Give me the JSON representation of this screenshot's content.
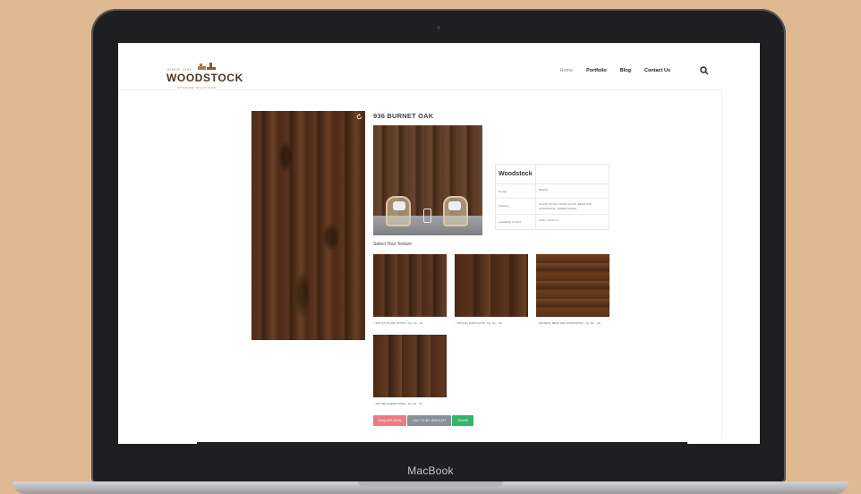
{
  "header": {
    "logo_small": "SINCE 1985",
    "logo_name": "WOODSTOCK",
    "logo_sub": "INTERIOR SOLUTIONS",
    "nav": [
      {
        "label": "Home",
        "active": true
      },
      {
        "label": "Portfolio",
        "active": false
      },
      {
        "label": "Blog",
        "active": false
      },
      {
        "label": "Contact Us",
        "active": false
      }
    ]
  },
  "product": {
    "title": "936 BURNET OAK",
    "spec": {
      "brand": "Woodstock",
      "rows": [
        {
          "label": "Design",
          "value": "BRAND"
        },
        {
          "label": "Features",
          "value": "PLANK STITCH, DESK GLASS, BEAN OAK HORIZONTAL, SUEDE FINISH"
        },
        {
          "label": "Availability & Sizes",
          "value": "1220 x 2440 mm"
        }
      ]
    },
    "select_label": "Select Your Texture",
    "textures": [
      {
        "caption": "936 (ST) PLANK STITCH - Pg. No. : 31"
      },
      {
        "caption": "936 (HG) RAW GLOSS - Pg. No. : 28"
      },
      {
        "caption": "936 (BHO) BEAN OAK HORIZONTAL - Pg. No. : 29"
      },
      {
        "caption": "936 (SE) SUEDE FINISH - Pg. No. : 11"
      }
    ],
    "buttons": {
      "enquiry": "ENQUIRE NOW",
      "wishlist": "ADD TO MY WISHLIST",
      "share": "SHARE"
    }
  },
  "laptop": {
    "brand": "MacBook"
  },
  "colors": {
    "background": "#deb992",
    "enquiry_button": "#ee7a82",
    "wishlist_button": "#8b8f9a",
    "share_button": "#32b66a"
  }
}
